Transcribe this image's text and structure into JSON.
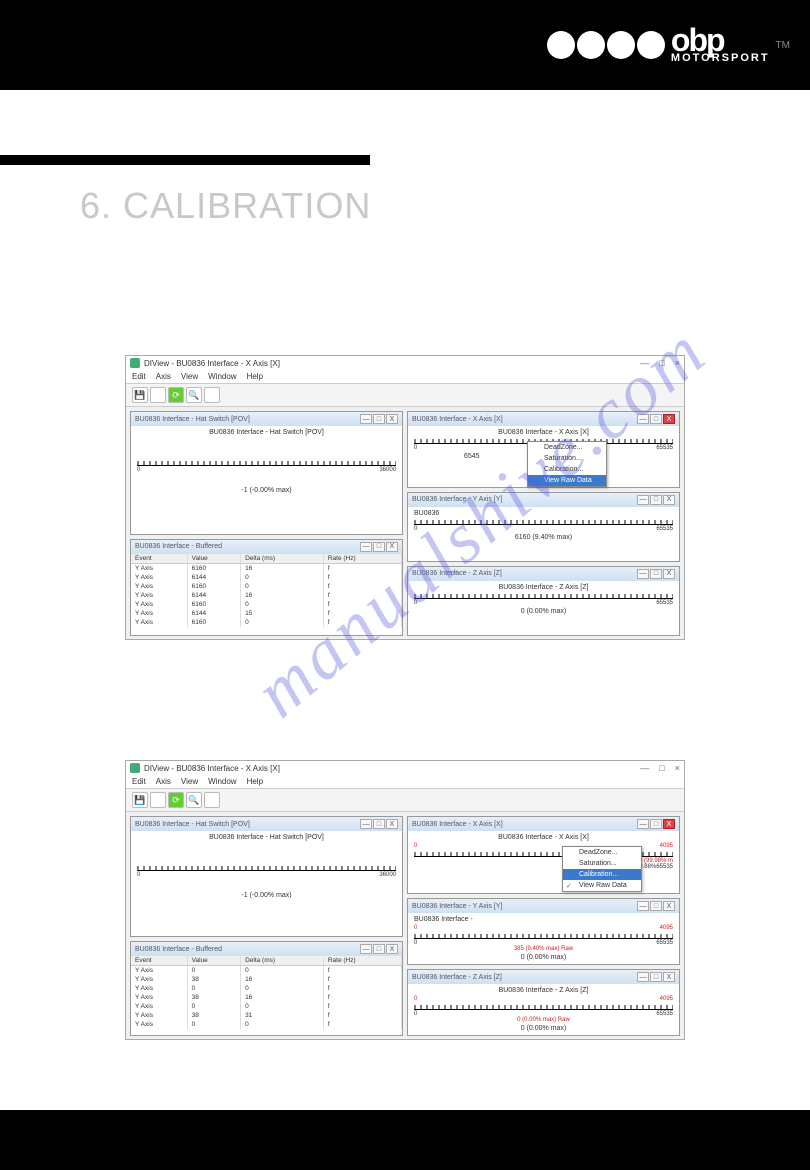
{
  "brand": {
    "name": "obp",
    "sub": "MOTORSPORT",
    "tm": "TM"
  },
  "section": {
    "num": "6.",
    "title": "CALIBRATION"
  },
  "watermark": "manualshive.com",
  "app": {
    "title": "DIView - BU0836 Interface - X Axis [X]",
    "menus": [
      "Edit",
      "Axis",
      "View",
      "Window",
      "Help"
    ]
  },
  "panel_controls": {
    "min": "—",
    "max": "□",
    "close": "X"
  },
  "context_menu": {
    "items": [
      "DeadZone...",
      "Saturation...",
      "Calibration...",
      "View Raw Data"
    ]
  },
  "shot1": {
    "hat": {
      "title_head": "BU0836 Interface - Hat Switch [POV]",
      "title": "BU0836 Interface - Hat Switch [POV]",
      "min": "0",
      "max": "36000",
      "status": "-1 (-0.00% max)"
    },
    "buffered": {
      "title_head": "BU0836 Interface - Buffered",
      "cols": [
        "Event",
        "Value",
        "Delta (ms)",
        "Rate (Hz)"
      ],
      "rows": [
        [
          "Y Axis",
          "6160",
          "16",
          "f"
        ],
        [
          "Y Axis",
          "6144",
          "0",
          "f"
        ],
        [
          "Y Axis",
          "6160",
          "0",
          "f"
        ],
        [
          "Y Axis",
          "6144",
          "16",
          "f"
        ],
        [
          "Y Axis",
          "6160",
          "0",
          "f"
        ],
        [
          "Y Axis",
          "6144",
          "15",
          "f"
        ],
        [
          "Y Axis",
          "6160",
          "0",
          "f"
        ]
      ]
    },
    "x": {
      "title_head": "BU0836 Interface - X Axis [X]",
      "title": "BU0836 Interface - X Axis [X]",
      "min": "0",
      "max": "65535",
      "cur": "6545",
      "selected_menu_idx": 3
    },
    "y": {
      "title_head": "BU0836 Interface - Y Axis [Y]",
      "title": "BU0836",
      "min": "0",
      "max": "65535",
      "status": "6160 (9.40% max)"
    },
    "z": {
      "title_head": "BU0836 Interface - Z Axis [Z]",
      "title": "BU0836 Interface - Z Axis [Z]",
      "min": "0",
      "max": "65535",
      "status": "0 (0.00% max)"
    }
  },
  "shot2": {
    "hat": {
      "title_head": "BU0836 Interface - Hat Switch [POV]",
      "title": "BU0836 Interface - Hat Switch [POV]",
      "min": "0",
      "max": "36000",
      "status": "-1 (-0.00% max)"
    },
    "buffered": {
      "title_head": "BU0836 Interface - Buffered",
      "cols": [
        "Event",
        "Value",
        "Delta (ms)",
        "Rate (Hz)"
      ],
      "rows": [
        [
          "Y Axis",
          "0",
          "0",
          "f"
        ],
        [
          "Y Axis",
          "38",
          "16",
          "f"
        ],
        [
          "Y Axis",
          "0",
          "0",
          "f"
        ],
        [
          "Y Axis",
          "38",
          "16",
          "f"
        ],
        [
          "Y Axis",
          "0",
          "0",
          "f"
        ],
        [
          "Y Axis",
          "38",
          "31",
          "f"
        ],
        [
          "Y Axis",
          "0",
          "0",
          "f"
        ]
      ]
    },
    "x": {
      "title_head": "BU0836 Interface - X Axis [X]",
      "title": "BU0836 Interface - X Axis [X]",
      "min": "0",
      "max": "4095",
      "line1": "4094 (99.98% m",
      "line2": "65458 (99.88%",
      "rmax": "65535",
      "selected_menu_idx": 2
    },
    "y": {
      "title_head": "BU0836 Interface - Y Axis [Y]",
      "title": "BU0836 Interface -",
      "min": "0",
      "max": "4095",
      "rmax": "65535",
      "line1": "385 (9.40% max)  Raw",
      "line2": "0 (0.00% max)"
    },
    "z": {
      "title_head": "BU0836 Interface - Z Axis [Z]",
      "title": "BU0836 Interface - Z Axis [Z]",
      "min": "0",
      "max": "4095",
      "rmax": "65535",
      "line1": "0 (0.00% max)  Raw",
      "line2": "0 (0.00% max)"
    }
  }
}
